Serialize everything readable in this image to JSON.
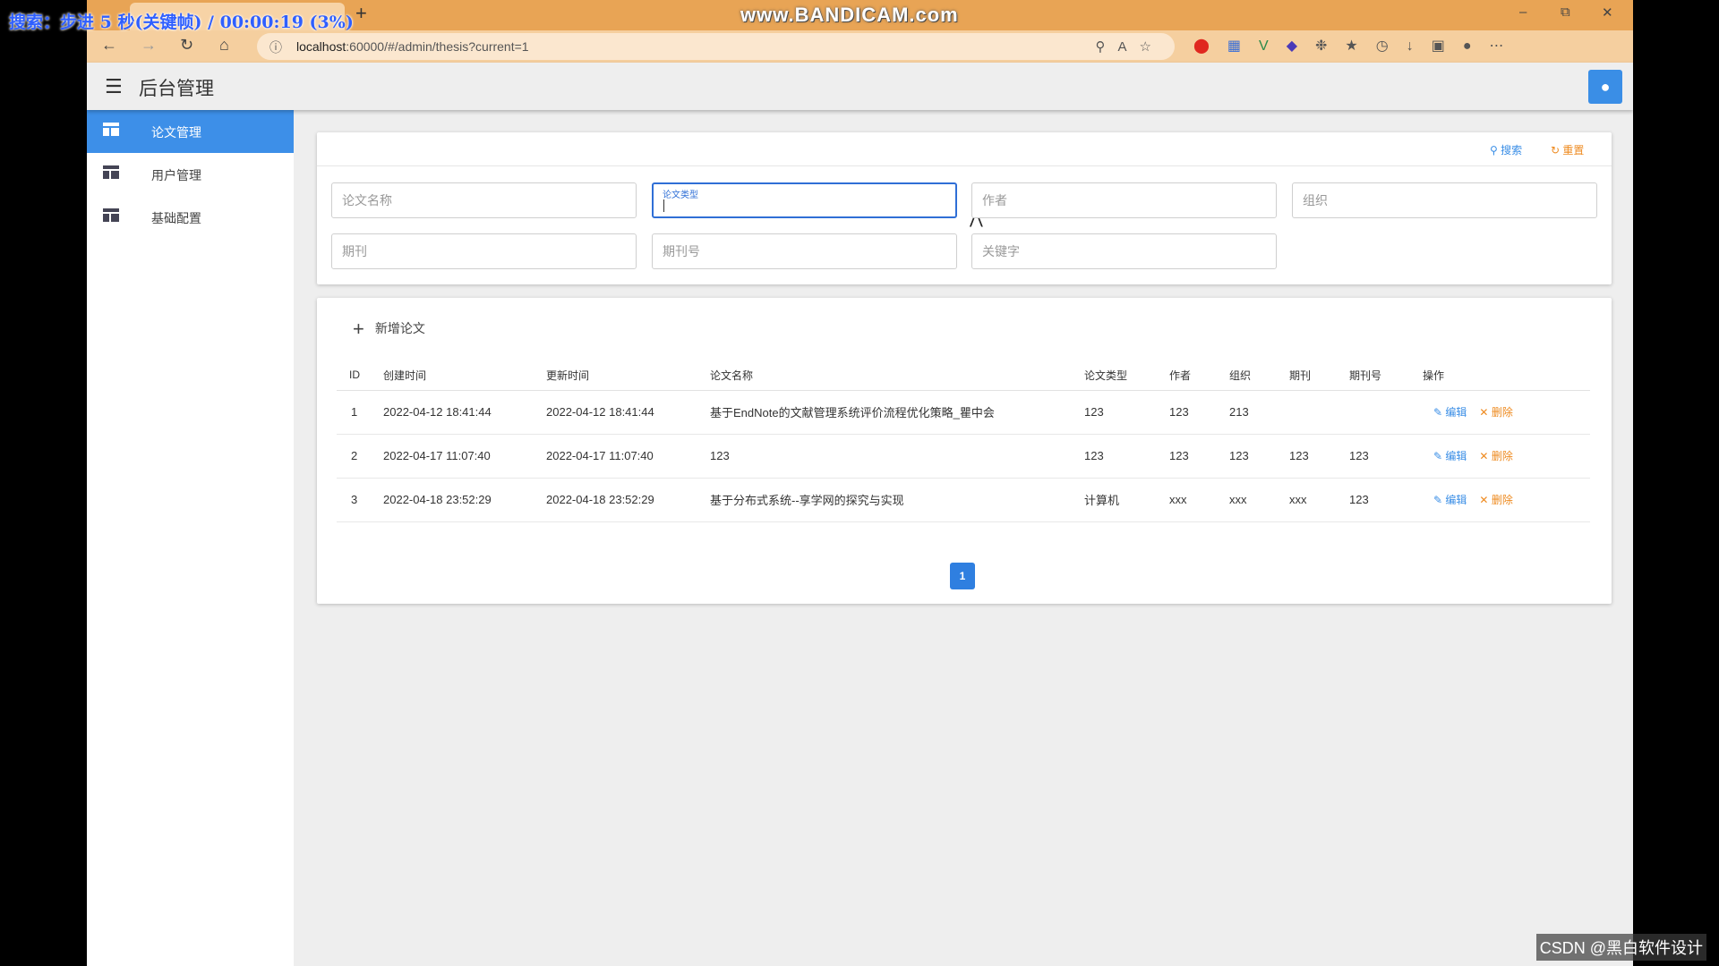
{
  "overlay": {
    "text": "搜索：步进 5 秒(关键帧) / 00:00:19 (3%)"
  },
  "browser": {
    "bandicam": "www.BANDICAM.com",
    "url_host": "localhost",
    "url_rest": ":60000/#/admin/thesis?current=1",
    "new_tab_label": "+"
  },
  "app": {
    "title": "后台管理",
    "sidebar": {
      "items": [
        {
          "label": "论文管理",
          "active": true
        },
        {
          "label": "用户管理",
          "active": false
        },
        {
          "label": "基础配置",
          "active": false
        }
      ]
    },
    "search": {
      "search_label": "搜索",
      "reset_label": "重置",
      "fields": {
        "thesis_name": "论文名称",
        "thesis_type": "论文类型",
        "author": "作者",
        "organization": "组织",
        "journal": "期刊",
        "journal_no": "期刊号",
        "keyword": "关键字"
      }
    },
    "table": {
      "add_label": "新增论文",
      "columns": [
        "ID",
        "创建时间",
        "更新时间",
        "论文名称",
        "论文类型",
        "作者",
        "组织",
        "期刊",
        "期刊号",
        "操作"
      ],
      "rows": [
        [
          "1",
          "2022-04-12 18:41:44",
          "2022-04-12 18:41:44",
          "基于EndNote的文献管理系统评价流程优化策略_瞿中会",
          "123",
          "123",
          "213",
          "",
          ""
        ],
        [
          "2",
          "2022-04-17 11:07:40",
          "2022-04-17 11:07:40",
          "123",
          "123",
          "123",
          "123",
          "123",
          "123"
        ],
        [
          "3",
          "2022-04-18 23:52:29",
          "2022-04-18 23:52:29",
          "基于分布式系统--享学网的探究与实现",
          "计算机",
          "xxx",
          "xxx",
          "xxx",
          "123"
        ]
      ],
      "edit_label": "编辑",
      "delete_label": "删除"
    },
    "pagination": {
      "current": "1"
    }
  },
  "watermark": "CSDN @黑白软件设计"
}
